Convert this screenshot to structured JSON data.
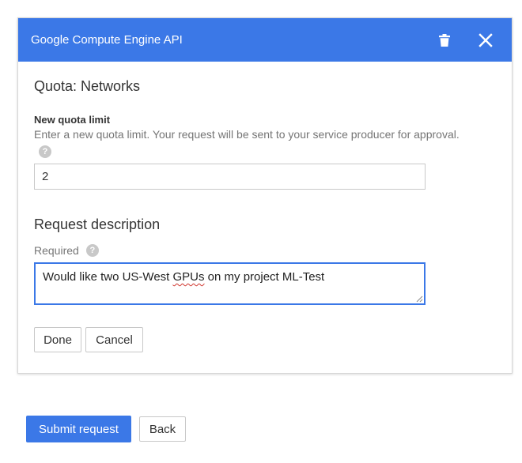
{
  "dialog": {
    "title": "Google Compute Engine API",
    "icons": {
      "delete": "trash-icon",
      "close": "close-icon"
    },
    "colors": {
      "header": "#3b78e7",
      "focus_border": "#3b78e7"
    }
  },
  "quota": {
    "heading": "Quota: Networks",
    "limit_label": "New quota limit",
    "limit_help": "Enter a new quota limit. Your request will be sent to your service producer for approval.",
    "help_icon_glyph": "?",
    "limit_value": "2"
  },
  "request": {
    "heading": "Request description",
    "required_label": "Required",
    "description_before": "Would like two US-West ",
    "description_flagged": "GPUs",
    "description_after": " on my project ML-Test"
  },
  "buttons": {
    "done": "Done",
    "cancel": "Cancel",
    "submit": "Submit request",
    "back": "Back"
  }
}
